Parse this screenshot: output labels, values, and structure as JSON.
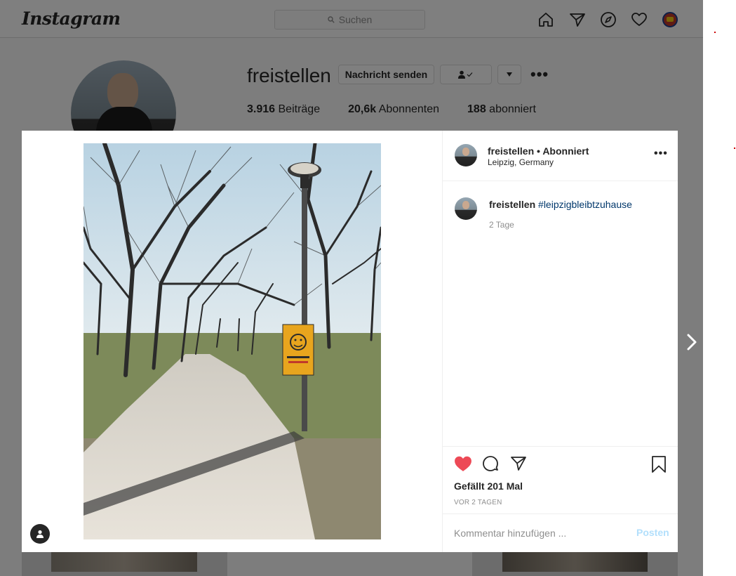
{
  "header": {
    "logo": "Instagram",
    "search_placeholder": "Suchen",
    "nav_icons": [
      "home-icon",
      "direct-icon",
      "explore-icon",
      "activity-heart-icon",
      "profile-avatar"
    ]
  },
  "profile": {
    "username": "freistellen",
    "message_button": "Nachricht senden",
    "stats": [
      {
        "value": "3.916",
        "label": "Beiträge"
      },
      {
        "value": "20,6k",
        "label": "Abonnenten"
      },
      {
        "value": "188",
        "label": "abonniert"
      }
    ]
  },
  "post": {
    "header": {
      "username": "freistellen",
      "separator": " • ",
      "follow_status": "Abonniert",
      "location": "Leipzig, Germany"
    },
    "caption": {
      "username": "freistellen",
      "hashtag": "#leipzigbleibtzuhause",
      "time": "2 Tage"
    },
    "likes": "Gefällt 201 Mal",
    "age": "VOR 2 TAGEN",
    "comment_placeholder": "Kommentar hinzufügen ...",
    "post_button": "Posten",
    "liked": true
  },
  "colors": {
    "like_red": "#ed4956",
    "hashtag_blue": "#00376b",
    "post_disabled": "#b2dffc",
    "muted": "#8e8e8e"
  }
}
